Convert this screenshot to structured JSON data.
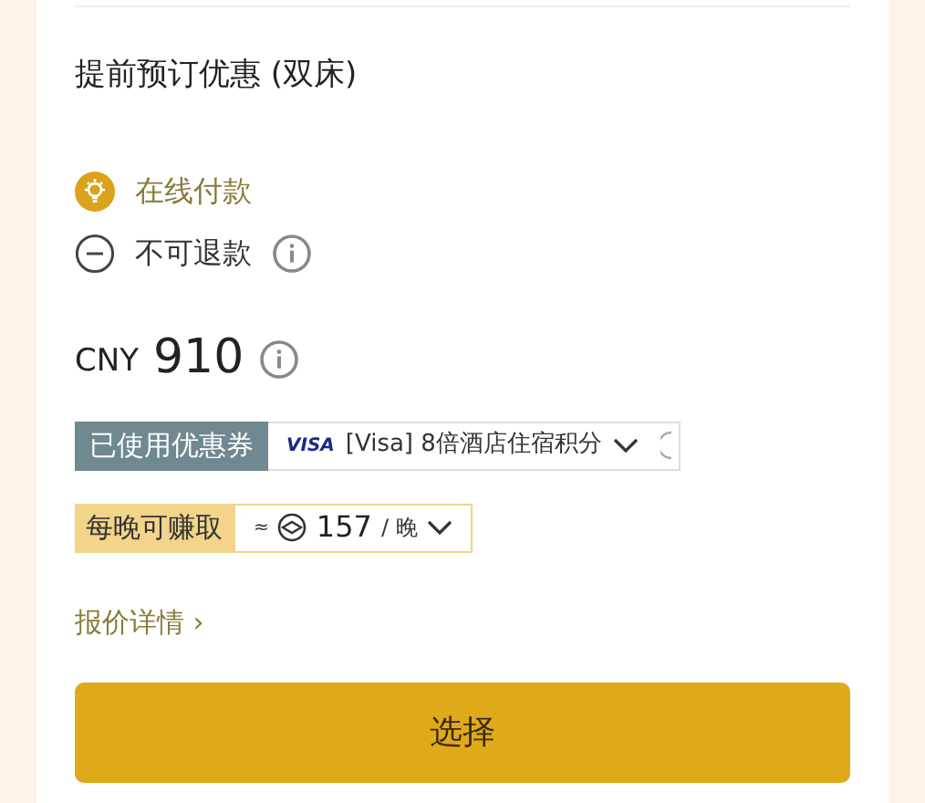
{
  "title": "提前预订优惠 (双床)",
  "policies": [
    {
      "kind": "highlight",
      "label": "在线付款"
    },
    {
      "kind": "restriction",
      "label": "不可退款"
    }
  ],
  "price": {
    "currency": "CNY",
    "amount": "910"
  },
  "coupon": {
    "label": "已使用优惠券",
    "card": "VISA",
    "text": "[Visa] 8倍酒店住宿积分"
  },
  "earn": {
    "label": "每晚可赚取",
    "approx": "≈",
    "points": "157",
    "unit": "/ 晚"
  },
  "details_link": "报价详情 ›",
  "select_button": "选择"
}
